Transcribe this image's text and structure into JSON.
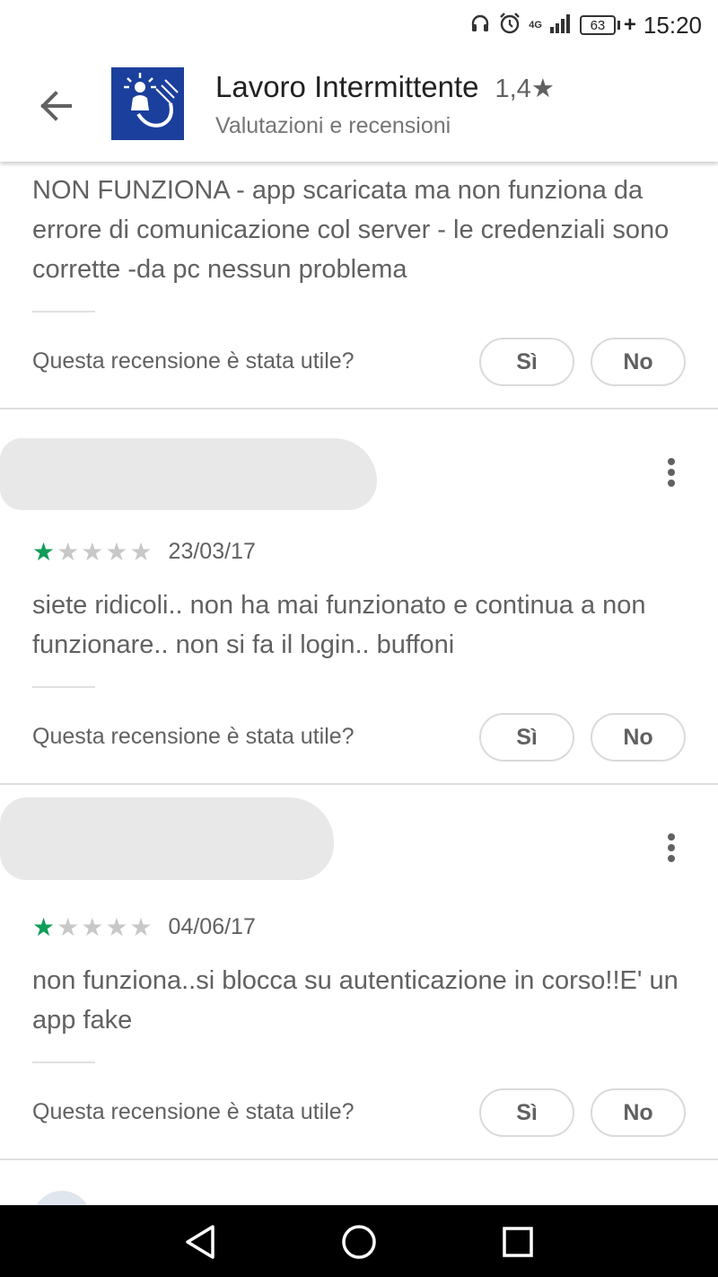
{
  "status_bar": {
    "time": "15:20",
    "battery": "63",
    "network": "4G",
    "icons": [
      "headphones-icon",
      "alarm-icon",
      "signal-icon",
      "battery-icon"
    ]
  },
  "header": {
    "back_icon": "arrow-back-icon",
    "app_title": "Lavoro Intermittente",
    "rating": "1,4",
    "subtitle": "Valutazioni e recensioni"
  },
  "reviews": [
    {
      "text": "NON FUNZIONA - app scaricata ma non funziona da errore di comunicazione col server - le credenziali sono corrette -da pc nessun problema",
      "helpful_question": "Questa recensione è stata utile?",
      "yes_label": "Sì",
      "no_label": "No"
    },
    {
      "stars": 1,
      "date": "23/03/17",
      "text": "siete ridicoli.. non ha mai funzionato e continua a non funzionare.. non si fa il login.. buffoni",
      "helpful_question": "Questa recensione è stata utile?",
      "yes_label": "Sì",
      "no_label": "No"
    },
    {
      "stars": 1,
      "date": "04/06/17",
      "text": "non funziona..si blocca su autenticazione in corso!!E' un app fake",
      "helpful_question": "Questa recensione è stata utile?",
      "yes_label": "Sì",
      "no_label": "No"
    }
  ],
  "nav_bar": {
    "icons": [
      "back-triangle-icon",
      "home-circle-icon",
      "recents-square-icon"
    ]
  },
  "colors": {
    "star_filled": "#0f9d58",
    "star_empty": "#c8c8c8",
    "app_icon_bg": "#1b3f9c"
  }
}
